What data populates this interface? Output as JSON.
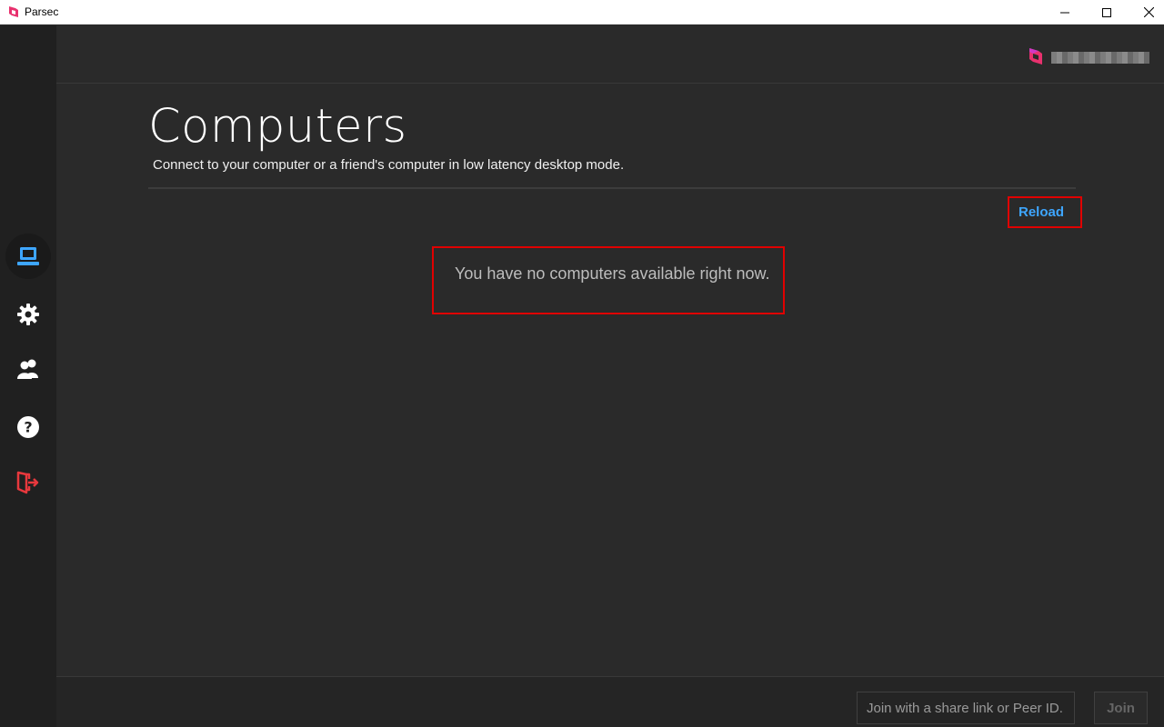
{
  "window": {
    "title": "Parsec"
  },
  "sidebar": {
    "items": [
      {
        "icon": "computer-icon",
        "active": true
      },
      {
        "icon": "gear-icon",
        "active": false
      },
      {
        "icon": "friends-icon",
        "active": false
      },
      {
        "icon": "help-icon",
        "active": false
      },
      {
        "icon": "logout-icon",
        "active": false
      }
    ]
  },
  "main": {
    "title": "Computers",
    "subtitle": "Connect to your computer or a friend's computer in low latency desktop mode.",
    "reload_label": "Reload",
    "empty_message": "You have no computers available right now."
  },
  "footer": {
    "join_placeholder": "Join with a share link or Peer ID.",
    "join_label": "Join"
  },
  "colors": {
    "accent_blue": "#3ea6ff",
    "brand_pink": "#ff2d6f",
    "logout_red": "#e8383d",
    "highlight_red": "#e00000",
    "background": "#2a2a2a",
    "sidebar": "#202020"
  }
}
